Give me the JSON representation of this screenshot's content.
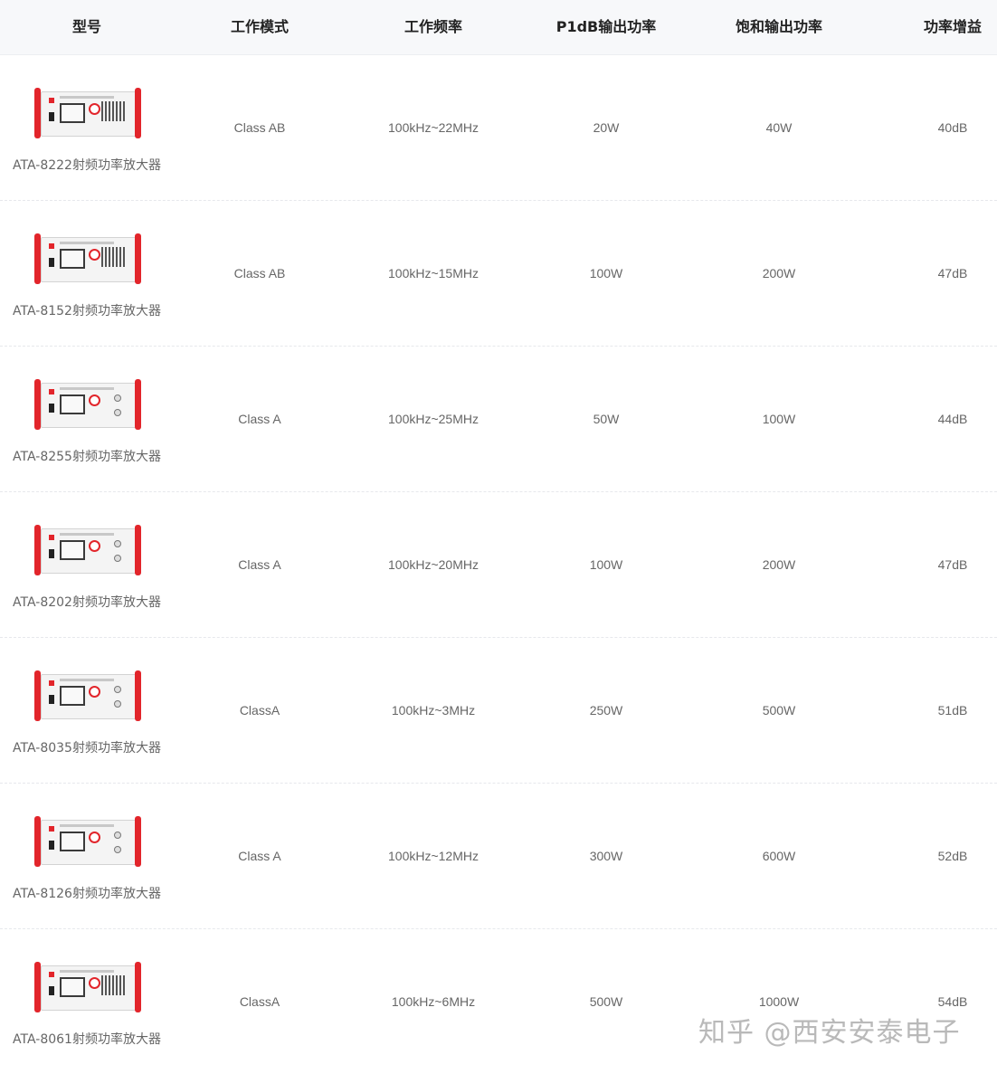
{
  "columns": [
    "型号",
    "工作模式",
    "工作频率",
    "P1dB输出功率",
    "饱和输出功率",
    "功率增益"
  ],
  "rows": [
    {
      "model": "ATA-8222射频功率放大器",
      "mode": "Class AB",
      "freq": "100kHz~22MHz",
      "p1db": "20W",
      "sat": "40W",
      "gain": "40dB",
      "image": "amplifier-front-panel-vented"
    },
    {
      "model": "ATA-8152射频功率放大器",
      "mode": "Class AB",
      "freq": "100kHz~15MHz",
      "p1db": "100W",
      "sat": "200W",
      "gain": "47dB",
      "image": "amplifier-front-panel-vented"
    },
    {
      "model": "ATA-8255射频功率放大器",
      "mode": "Class A",
      "freq": "100kHz~25MHz",
      "p1db": "50W",
      "sat": "100W",
      "gain": "44dB",
      "image": "amplifier-front-panel"
    },
    {
      "model": "ATA-8202射频功率放大器",
      "mode": "Class A",
      "freq": "100kHz~20MHz",
      "p1db": "100W",
      "sat": "200W",
      "gain": "47dB",
      "image": "amplifier-front-panel"
    },
    {
      "model": "ATA-8035射频功率放大器",
      "mode": "ClassA",
      "freq": "100kHz~3MHz",
      "p1db": "250W",
      "sat": "500W",
      "gain": "51dB",
      "image": "amplifier-front-panel"
    },
    {
      "model": "ATA-8126射频功率放大器",
      "mode": "Class A",
      "freq": "100kHz~12MHz",
      "p1db": "300W",
      "sat": "600W",
      "gain": "52dB",
      "image": "amplifier-front-panel"
    },
    {
      "model": "ATA-8061射频功率放大器",
      "mode": "ClassA",
      "freq": "100kHz~6MHz",
      "p1db": "500W",
      "sat": "1000W",
      "gain": "54dB",
      "image": "amplifier-front-panel-vented"
    }
  ],
  "watermark": "知乎 @西安安泰电子",
  "colors": {
    "accent": "#e2252b",
    "header_bg": "#f7f8fa",
    "text": "#666666"
  }
}
